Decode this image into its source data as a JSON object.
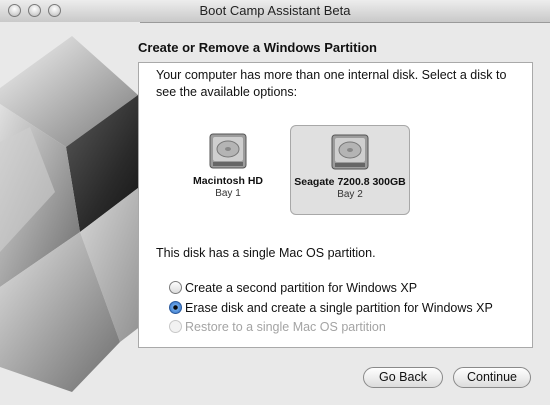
{
  "window": {
    "title": "Boot Camp Assistant Beta"
  },
  "page": {
    "heading": "Create or Remove a Windows Partition",
    "intro": "Your computer has more than one internal disk. Select a disk to see the available options:"
  },
  "disks": [
    {
      "name": "Macintosh HD",
      "bay": "Bay 1",
      "selected": false
    },
    {
      "name": "Seagate 7200.8 300GB",
      "bay": "Bay 2",
      "selected": true
    }
  ],
  "status": "This disk has a single Mac OS partition.",
  "options": [
    {
      "label": "Create a second partition for Windows XP",
      "state": "unselected"
    },
    {
      "label": "Erase disk and create a single partition for Windows XP",
      "state": "selected"
    },
    {
      "label": "Restore to a single Mac OS partition",
      "state": "disabled"
    }
  ],
  "buttons": {
    "back": "Go Back",
    "continue": "Continue"
  }
}
